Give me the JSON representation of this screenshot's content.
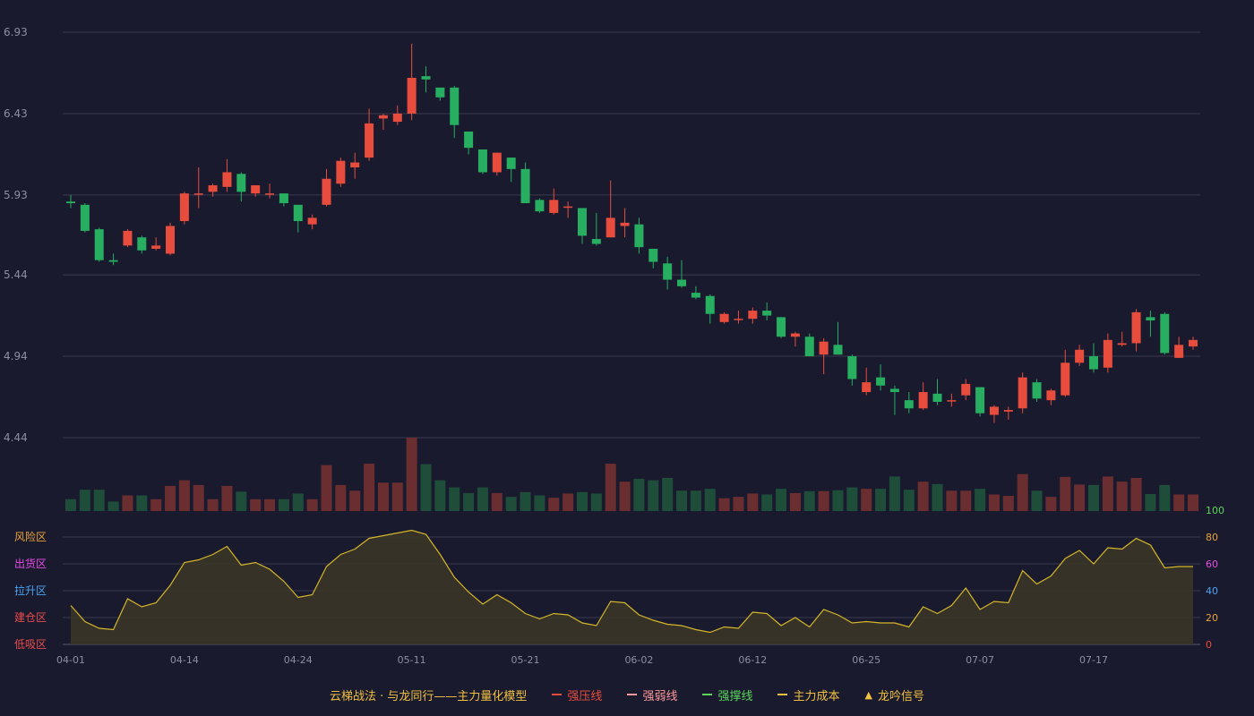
{
  "colors": {
    "background": "#1a1a2e",
    "up": "#e74c3c",
    "down": "#27ae60",
    "up_volume": "#6b2e30",
    "down_volume": "#1e4d3a",
    "grid": "#3a3a50",
    "axis_text": "#8b8fa3",
    "oscillator": "#d4b628",
    "oscillator_fill": "#3b3528"
  },
  "chart_data": [
    {
      "type": "candlestick",
      "ylim": [
        4.44,
        6.93
      ],
      "y_ticks": [
        "6.93",
        "6.43",
        "5.93",
        "5.44",
        "4.94",
        "4.44"
      ],
      "x_ticks": [
        "04-01",
        "04-14",
        "04-24",
        "05-11",
        "05-21",
        "06-02",
        "06-12",
        "06-25",
        "07-07",
        "07-17"
      ],
      "x_tick_index": [
        0,
        8,
        16,
        24,
        32,
        40,
        48,
        56,
        64,
        72
      ],
      "ohlc": [
        [
          5.89,
          5.93,
          5.85,
          5.88
        ],
        [
          5.87,
          5.88,
          5.7,
          5.71
        ],
        [
          5.72,
          5.73,
          5.52,
          5.53
        ],
        [
          5.53,
          5.57,
          5.5,
          5.52
        ],
        [
          5.62,
          5.72,
          5.61,
          5.71
        ],
        [
          5.67,
          5.68,
          5.57,
          5.59
        ],
        [
          5.6,
          5.67,
          5.59,
          5.62
        ],
        [
          5.57,
          5.76,
          5.56,
          5.74
        ],
        [
          5.77,
          5.95,
          5.75,
          5.94
        ],
        [
          5.94,
          6.1,
          5.85,
          5.94
        ],
        [
          5.95,
          6.0,
          5.92,
          5.99
        ],
        [
          5.98,
          6.15,
          5.95,
          6.07
        ],
        [
          6.06,
          6.07,
          5.89,
          5.95
        ],
        [
          5.94,
          5.99,
          5.92,
          5.99
        ],
        [
          5.94,
          6.0,
          5.91,
          5.94
        ],
        [
          5.94,
          5.94,
          5.86,
          5.88
        ],
        [
          5.87,
          5.87,
          5.7,
          5.77
        ],
        [
          5.75,
          5.81,
          5.72,
          5.79
        ],
        [
          5.87,
          6.09,
          5.86,
          6.03
        ],
        [
          6.0,
          6.16,
          5.98,
          6.14
        ],
        [
          6.1,
          6.19,
          6.03,
          6.13
        ],
        [
          6.16,
          6.46,
          6.14,
          6.37
        ],
        [
          6.4,
          6.43,
          6.33,
          6.42
        ],
        [
          6.38,
          6.48,
          6.36,
          6.43
        ],
        [
          6.43,
          6.86,
          6.39,
          6.65
        ],
        [
          6.66,
          6.72,
          6.56,
          6.64
        ],
        [
          6.59,
          6.59,
          6.51,
          6.53
        ],
        [
          6.59,
          6.6,
          6.28,
          6.36
        ],
        [
          6.32,
          6.32,
          6.18,
          6.22
        ],
        [
          6.21,
          6.21,
          6.06,
          6.07
        ],
        [
          6.07,
          6.19,
          6.05,
          6.19
        ],
        [
          6.16,
          6.16,
          6.01,
          6.09
        ],
        [
          6.09,
          6.13,
          5.88,
          5.88
        ],
        [
          5.9,
          5.91,
          5.82,
          5.83
        ],
        [
          5.82,
          5.97,
          5.81,
          5.9
        ],
        [
          5.86,
          5.89,
          5.79,
          5.86
        ],
        [
          5.85,
          5.85,
          5.63,
          5.68
        ],
        [
          5.66,
          5.82,
          5.62,
          5.63
        ],
        [
          5.67,
          6.02,
          5.67,
          5.79
        ],
        [
          5.74,
          5.85,
          5.67,
          5.76
        ],
        [
          5.75,
          5.79,
          5.57,
          5.61
        ],
        [
          5.6,
          5.6,
          5.48,
          5.52
        ],
        [
          5.51,
          5.55,
          5.35,
          5.41
        ],
        [
          5.41,
          5.53,
          5.36,
          5.37
        ],
        [
          5.33,
          5.37,
          5.29,
          5.3
        ],
        [
          5.31,
          5.32,
          5.14,
          5.2
        ],
        [
          5.15,
          5.21,
          5.14,
          5.2
        ],
        [
          5.17,
          5.22,
          5.14,
          5.17
        ],
        [
          5.17,
          5.24,
          5.14,
          5.22
        ],
        [
          5.22,
          5.27,
          5.16,
          5.19
        ],
        [
          5.18,
          5.18,
          5.05,
          5.06
        ],
        [
          5.06,
          5.09,
          5.0,
          5.08
        ],
        [
          5.06,
          5.08,
          4.94,
          4.94
        ],
        [
          4.95,
          5.05,
          4.83,
          5.03
        ],
        [
          5.01,
          5.15,
          4.95,
          4.95
        ],
        [
          4.94,
          4.95,
          4.76,
          4.8
        ],
        [
          4.72,
          4.87,
          4.7,
          4.78
        ],
        [
          4.81,
          4.89,
          4.73,
          4.76
        ],
        [
          4.74,
          4.76,
          4.58,
          4.72
        ],
        [
          4.67,
          4.72,
          4.59,
          4.62
        ],
        [
          4.62,
          4.78,
          4.61,
          4.72
        ],
        [
          4.71,
          4.8,
          4.64,
          4.66
        ],
        [
          4.67,
          4.71,
          4.63,
          4.67
        ],
        [
          4.7,
          4.8,
          4.67,
          4.77
        ],
        [
          4.75,
          4.75,
          4.57,
          4.59
        ],
        [
          4.58,
          4.64,
          4.53,
          4.63
        ],
        [
          4.6,
          4.63,
          4.55,
          4.61
        ],
        [
          4.62,
          4.84,
          4.59,
          4.81
        ],
        [
          4.78,
          4.8,
          4.66,
          4.68
        ],
        [
          4.67,
          4.74,
          4.64,
          4.73
        ],
        [
          4.7,
          4.98,
          4.69,
          4.9
        ],
        [
          4.9,
          5.01,
          4.88,
          4.98
        ],
        [
          4.94,
          5.02,
          4.84,
          4.86
        ],
        [
          4.87,
          5.08,
          4.84,
          5.04
        ],
        [
          5.01,
          5.09,
          5.0,
          5.02
        ],
        [
          5.02,
          5.23,
          4.97,
          5.21
        ],
        [
          5.18,
          5.22,
          5.06,
          5.16
        ],
        [
          5.2,
          5.21,
          4.95,
          4.96
        ],
        [
          4.93,
          5.06,
          4.93,
          5.01
        ],
        [
          5.0,
          5.06,
          4.98,
          5.04
        ]
      ],
      "volume": [
        0.25,
        0.45,
        0.45,
        0.2,
        0.33,
        0.33,
        0.25,
        0.53,
        0.65,
        0.55,
        0.25,
        0.53,
        0.41,
        0.25,
        0.25,
        0.25,
        0.37,
        0.25,
        0.97,
        0.55,
        0.43,
        1.0,
        0.6,
        0.6,
        1.55,
        0.99,
        0.65,
        0.5,
        0.38,
        0.5,
        0.38,
        0.3,
        0.4,
        0.33,
        0.28,
        0.37,
        0.4,
        0.37,
        1.0,
        0.62,
        0.68,
        0.65,
        0.7,
        0.43,
        0.43,
        0.47,
        0.27,
        0.3,
        0.37,
        0.35,
        0.47,
        0.38,
        0.42,
        0.42,
        0.44,
        0.5,
        0.47,
        0.47,
        0.73,
        0.45,
        0.62,
        0.57,
        0.43,
        0.43,
        0.47,
        0.35,
        0.32,
        0.78,
        0.43,
        0.3,
        0.72,
        0.56,
        0.55,
        0.73,
        0.62,
        0.7,
        0.36,
        0.55,
        0.35,
        0.35
      ]
    },
    {
      "type": "area",
      "ylim": [
        0,
        100
      ],
      "y_ticks": [
        {
          "label": "0",
          "color": "#e74c3c"
        },
        {
          "label": "20",
          "color": "#e8a33a"
        },
        {
          "label": "40",
          "color": "#4aa3f0"
        },
        {
          "label": "60",
          "color": "#e64ce6"
        },
        {
          "label": "80",
          "color": "#e8a33a"
        },
        {
          "label": "100",
          "color": "#5ad65a"
        }
      ],
      "zone_labels": [
        {
          "label": "风险区",
          "color": "#e8a33a"
        },
        {
          "label": "出货区",
          "color": "#e64ce6"
        },
        {
          "label": "拉升区",
          "color": "#4aa3f0"
        },
        {
          "label": "建仓区",
          "color": "#e84c4c"
        },
        {
          "label": "低吸区",
          "color": "#e84c4c"
        }
      ],
      "values": [
        29,
        17,
        12,
        11,
        34,
        28,
        31,
        44,
        61,
        63,
        67,
        73,
        59,
        61,
        56,
        47,
        35,
        37,
        58,
        67,
        71,
        79,
        81,
        83,
        85,
        82,
        67,
        50,
        39,
        30,
        37,
        31,
        23,
        19,
        23,
        22,
        16,
        14,
        32,
        31,
        22,
        18,
        15,
        14,
        11,
        9,
        13,
        12,
        24,
        23,
        14,
        20,
        13,
        26,
        22,
        16,
        17,
        16,
        16,
        13,
        28,
        23,
        29,
        42,
        26,
        32,
        31,
        55,
        45,
        51,
        64,
        70,
        60,
        72,
        71,
        79,
        74,
        57,
        58,
        58
      ]
    }
  ],
  "legend": {
    "title": "云梯战法 · 与龙同行——主力量化模型",
    "items": [
      {
        "label": "强压线",
        "color": "#e74c3c",
        "symbol": "solid"
      },
      {
        "label": "强弱线",
        "color": "#ff9999",
        "symbol": "dash"
      },
      {
        "label": "强撑线",
        "color": "#5ad65a",
        "symbol": "solid"
      },
      {
        "label": "主力成本",
        "color": "#f0c040",
        "symbol": "dash"
      },
      {
        "label": "龙吟信号",
        "color": "#f0c040",
        "symbol": "triangle"
      }
    ]
  }
}
